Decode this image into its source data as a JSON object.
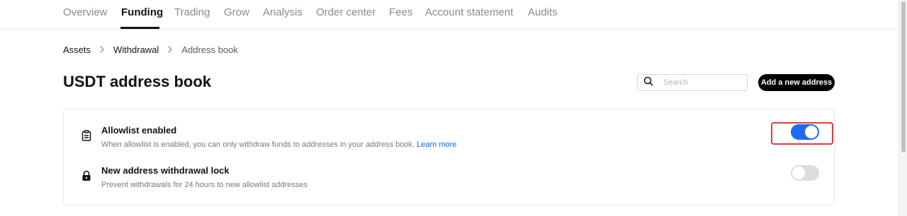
{
  "nav": {
    "tabs": [
      {
        "label": "Overview"
      },
      {
        "label": "Funding"
      },
      {
        "label": "Trading"
      },
      {
        "label": "Grow"
      },
      {
        "label": "Analysis"
      },
      {
        "label": "Order center"
      },
      {
        "label": "Fees"
      },
      {
        "label": "Account statement"
      },
      {
        "label": "Audits"
      }
    ],
    "active": "Funding"
  },
  "breadcrumb": {
    "items": [
      {
        "label": "Assets"
      },
      {
        "label": "Withdrawal"
      },
      {
        "label": "Address book"
      }
    ]
  },
  "page": {
    "title": "USDT address book"
  },
  "search": {
    "placeholder": "Search",
    "value": ""
  },
  "actions": {
    "add_label": "Add a new address"
  },
  "settings": [
    {
      "title": "Allowlist enabled",
      "description": "When allowlist is enabled, you can only withdraw funds to addresses in your address book.",
      "link": "Learn more",
      "enabled": true,
      "icon": "clipboard-icon"
    },
    {
      "title": "New address withdrawal lock",
      "description": "Prevent withdrawals for 24 hours to new allowlist addresses",
      "enabled": false,
      "icon": "lock-icon"
    }
  ],
  "colors": {
    "toggle_on": "#1c6cf0",
    "toggle_off": "#dcdcdc",
    "highlight": "#e03a3a",
    "link": "#0a6bd8"
  }
}
